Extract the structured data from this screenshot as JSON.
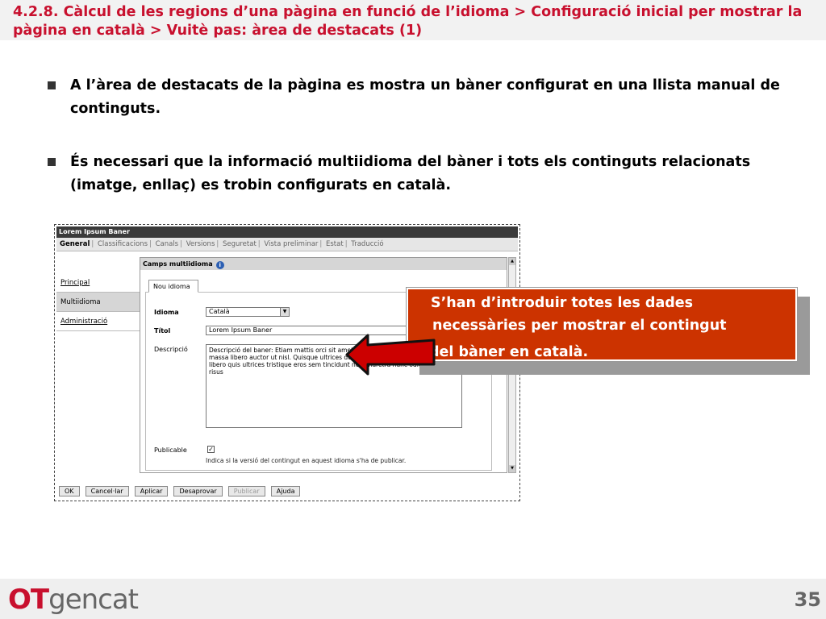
{
  "slide": {
    "title": "4.2.8. Càlcul de les regions d’una pàgina en funció de l’idioma > Configuració inicial per mostrar la pàgina en català > Vuitè pas: àrea de destacats (1)",
    "bullets": [
      "A l’àrea de destacats de la pàgina es mostra un bàner configurat en una llista manual de continguts.",
      "És necessari que la informació multiidioma del bàner i tots els continguts relacionats (imatge, enllaç) es trobin configurats en català."
    ],
    "callout": {
      "line1": "S’han d’introduir totes les dades",
      "line2": "necessàries per mostrar el contingut",
      "line3": "del bàner en català."
    },
    "footer": {
      "logo_ot": "OT",
      "logo_gencat": "gencat",
      "page_number": "35"
    },
    "colors": {
      "title": "#c8102e",
      "callout_bg": "#cc3300",
      "arrow": "#cc0000"
    }
  },
  "app": {
    "window_title": "Lorem Ipsum Baner",
    "tabs": [
      "General",
      "Classificacions",
      "Canals",
      "Versions",
      "Seguretat",
      "Vista preliminar",
      "Estat",
      "Traducció"
    ],
    "active_tab": "General",
    "nav": [
      "Principal",
      "Multiidioma",
      "Administració"
    ],
    "nav_selected": "Multiidioma",
    "panel_title": "Camps multiidioma",
    "inner_tab": "Nou idioma",
    "inner_close": "_",
    "form": {
      "idioma_label": "Idioma",
      "idioma_value": "Català",
      "titol_label": "Títol",
      "titol_value": "Lorem Ipsum Baner",
      "descripcio_label": "Descripció",
      "descripcio_value": "Descripció del baner: Etiam mattis orci sit amet ornare tellus venenatis. Etiam massa libero auctor ut nisl. Quisque ultrices dui a diam vestibulum. In ornare, libero quis ultrices tristique eros sem tincidunt nec pharetra nunc odio faucibus risus",
      "publicable_label": "Publicable",
      "publicable_checked": "✓",
      "publicable_hint": "Indica si la versió del contingut en aquest idioma s'ha de publicar."
    },
    "buttons": [
      "OK",
      "Cancel·lar",
      "Aplicar",
      "Desaprovar",
      "Publicar",
      "Ajuda"
    ],
    "disabled_button": "Publicar"
  }
}
